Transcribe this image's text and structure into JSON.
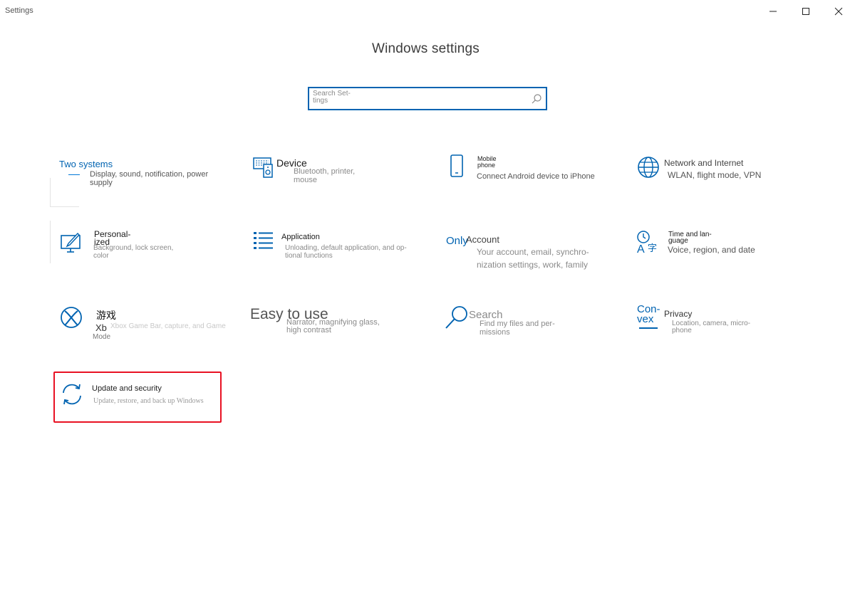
{
  "window": {
    "app_title": "Settings",
    "controls": {
      "minimize_icon": "minimize-icon",
      "maximize_icon": "maximize-icon",
      "close_icon": "close-icon"
    }
  },
  "page_title": "Windows settings",
  "search": {
    "placeholder": "Search Set-\ntings",
    "icon": "search-icon"
  },
  "accent_color": "#0063b1",
  "highlight_color": "#e81123",
  "tiles": [
    {
      "title": "Two systems",
      "description": "Display, sound, notification, power supply",
      "icon": "monitor-icon"
    },
    {
      "title": "Device",
      "description": "Bluetooth, printer,\nmouse",
      "icon": "devices-icon"
    },
    {
      "title": "Mobile\nphone",
      "description": "Connect Android device to iPhone",
      "icon": "phone-icon"
    },
    {
      "title": "Network and Internet",
      "description": "WLAN, flight mode, VPN",
      "icon": "globe-icon"
    },
    {
      "title": "Personal-\nized",
      "description": "Background, lock screen,\ncolor",
      "icon": "personalize-icon"
    },
    {
      "title": "Application",
      "description": "Unloading, default application, and op-\ntional functions",
      "icon": "apps-icon"
    },
    {
      "title": "Account",
      "label": "Only",
      "description": "Your account, email, synchro-\nnization settings, work, family",
      "icon": "account-icon"
    },
    {
      "title": "Time and lan-\nguage",
      "description": "Voice, region, and date",
      "icon": "time-language-icon"
    },
    {
      "title": "游戏",
      "sub": "Xb",
      "mode": "Mode",
      "description": "Xbox Game Bar, capture, and Game",
      "icon": "xbox-icon"
    },
    {
      "title": "Easy to use",
      "description": "Narrator, magnifying glass,\nhigh contrast",
      "icon": "ease-of-access-icon"
    },
    {
      "title": "Search",
      "description": "Find my files and per-\nmissions",
      "icon": "search-icon"
    },
    {
      "title": "Privacy",
      "label": "Con-\nvex",
      "description": "Location, camera, micro-\nphone",
      "icon": "privacy-icon"
    },
    {
      "title": "Update and security",
      "description": "Update, restore, and back up Windows",
      "icon": "sync-icon"
    }
  ]
}
